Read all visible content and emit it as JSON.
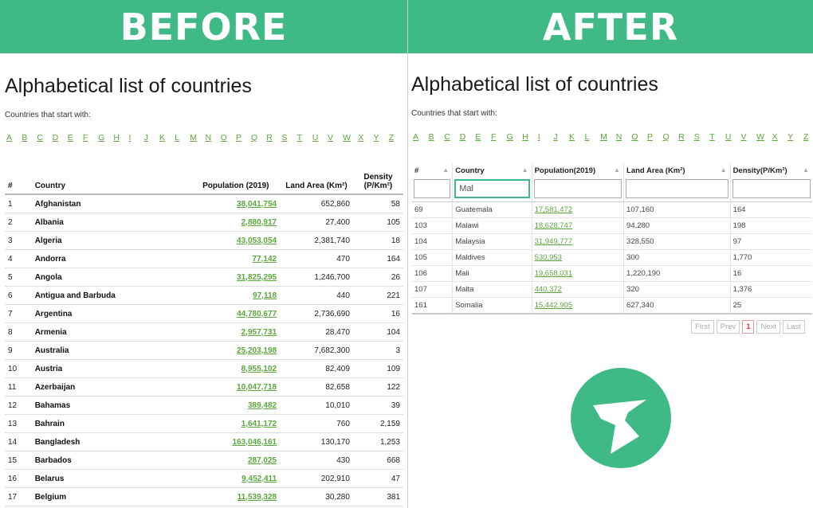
{
  "banner": {
    "before": "BEFORE",
    "after": "AFTER"
  },
  "accent_color": "#3fba86",
  "link_color": "#5aa83c",
  "logo_icon": "tablesorter-t-icon",
  "before": {
    "title": "Alphabetical list of countries",
    "subtitle": "Countries that start with:",
    "letters": [
      "A",
      "B",
      "C",
      "D",
      "E",
      "F",
      "G",
      "H",
      "I",
      "J",
      "K",
      "L",
      "M",
      "N",
      "O",
      "P",
      "Q",
      "R",
      "S",
      "T",
      "U",
      "V",
      "W",
      "X",
      "Y",
      "Z"
    ],
    "columns": {
      "idx": "#",
      "country": "Country",
      "population": "Population (2019)",
      "land": "Land Area (Km²)",
      "density": "Density (P/Km²)"
    },
    "rows": [
      {
        "idx": "1",
        "country": "Afghanistan",
        "population": "38,041,754",
        "land": "652,860",
        "density": "58"
      },
      {
        "idx": "2",
        "country": "Albania",
        "population": "2,880,917",
        "land": "27,400",
        "density": "105"
      },
      {
        "idx": "3",
        "country": "Algeria",
        "population": "43,053,054",
        "land": "2,381,740",
        "density": "18"
      },
      {
        "idx": "4",
        "country": "Andorra",
        "population": "77,142",
        "land": "470",
        "density": "164"
      },
      {
        "idx": "5",
        "country": "Angola",
        "population": "31,825,295",
        "land": "1,246,700",
        "density": "26"
      },
      {
        "idx": "6",
        "country": "Antigua and Barbuda",
        "population": "97,118",
        "land": "440",
        "density": "221"
      },
      {
        "idx": "7",
        "country": "Argentina",
        "population": "44,780,677",
        "land": "2,736,690",
        "density": "16"
      },
      {
        "idx": "8",
        "country": "Armenia",
        "population": "2,957,731",
        "land": "28,470",
        "density": "104"
      },
      {
        "idx": "9",
        "country": "Australia",
        "population": "25,203,198",
        "land": "7,682,300",
        "density": "3"
      },
      {
        "idx": "10",
        "country": "Austria",
        "population": "8,955,102",
        "land": "82,409",
        "density": "109"
      },
      {
        "idx": "11",
        "country": "Azerbaijan",
        "population": "10,047,718",
        "land": "82,658",
        "density": "122"
      },
      {
        "idx": "12",
        "country": "Bahamas",
        "population": "389,482",
        "land": "10,010",
        "density": "39"
      },
      {
        "idx": "13",
        "country": "Bahrain",
        "population": "1,641,172",
        "land": "760",
        "density": "2,159"
      },
      {
        "idx": "14",
        "country": "Bangladesh",
        "population": "163,046,161",
        "land": "130,170",
        "density": "1,253"
      },
      {
        "idx": "15",
        "country": "Barbados",
        "population": "287,025",
        "land": "430",
        "density": "668"
      },
      {
        "idx": "16",
        "country": "Belarus",
        "population": "9,452,411",
        "land": "202,910",
        "density": "47"
      },
      {
        "idx": "17",
        "country": "Belgium",
        "population": "11,539,328",
        "land": "30,280",
        "density": "381"
      }
    ]
  },
  "after": {
    "title": "Alphabetical list of countries",
    "subtitle": "Countries that start with:",
    "letters": [
      "A",
      "B",
      "C",
      "D",
      "E",
      "F",
      "G",
      "H",
      "I",
      "J",
      "K",
      "L",
      "M",
      "N",
      "O",
      "P",
      "Q",
      "R",
      "S",
      "T",
      "U",
      "V",
      "W",
      "X",
      "Y",
      "Z"
    ],
    "columns": {
      "idx": "#",
      "country": "Country",
      "population": "Population(2019)",
      "land": "Land Area (Km²)",
      "density": "Density(P/Km²)"
    },
    "filter_country_value": "Mal",
    "rows": [
      {
        "idx": "69",
        "country": "Guatemala",
        "population": "17,581,472",
        "land": "107,160",
        "density": "164"
      },
      {
        "idx": "103",
        "country": "Malawi",
        "population": "18,628,747",
        "land": "94,280",
        "density": "198"
      },
      {
        "idx": "104",
        "country": "Malaysia",
        "population": "31,949,777",
        "land": "328,550",
        "density": "97"
      },
      {
        "idx": "105",
        "country": "Maldives",
        "population": "530,953",
        "land": "300",
        "density": "1,770"
      },
      {
        "idx": "106",
        "country": "Mali",
        "population": "19,658,031",
        "land": "1,220,190",
        "density": "16"
      },
      {
        "idx": "107",
        "country": "Malta",
        "population": "440,372",
        "land": "320",
        "density": "1,376"
      },
      {
        "idx": "161",
        "country": "Somalia",
        "population": "15,442,905",
        "land": "627,340",
        "density": "25"
      }
    ],
    "pager": {
      "first": "First",
      "prev": "Prev",
      "current": "1",
      "next": "Next",
      "last": "Last"
    }
  }
}
